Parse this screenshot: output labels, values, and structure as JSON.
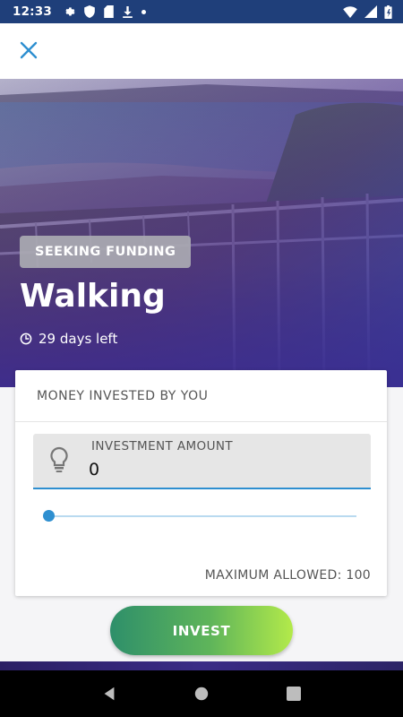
{
  "status_bar": {
    "time": "12:33",
    "icons": [
      "settings-icon",
      "shield-icon",
      "sd-card-icon",
      "download-icon",
      "dot-icon",
      "wifi-icon",
      "signal-icon",
      "battery-icon"
    ]
  },
  "app_bar": {
    "close_icon": "close-icon"
  },
  "hero": {
    "badge": "SEEKING FUNDING",
    "title": "Walking",
    "days_left": "29 days left",
    "clock_icon": "clock-icon"
  },
  "card": {
    "header": "MONEY INVESTED BY YOU",
    "field_label": "INVESTMENT AMOUNT",
    "field_value": "0",
    "field_icon": "lightbulb-icon",
    "slider_value": 0,
    "max_allowed": "MAXIMUM ALLOWED: 100"
  },
  "invest_button": "INVEST",
  "colors": {
    "accent_blue": "#2e8fd0",
    "button_gradient_start": "#2e8f6a",
    "button_gradient_end": "#b3ea4a",
    "hero_overlay": "#4b2a8c"
  },
  "nav": [
    "back-icon",
    "home-icon",
    "recents-icon"
  ]
}
